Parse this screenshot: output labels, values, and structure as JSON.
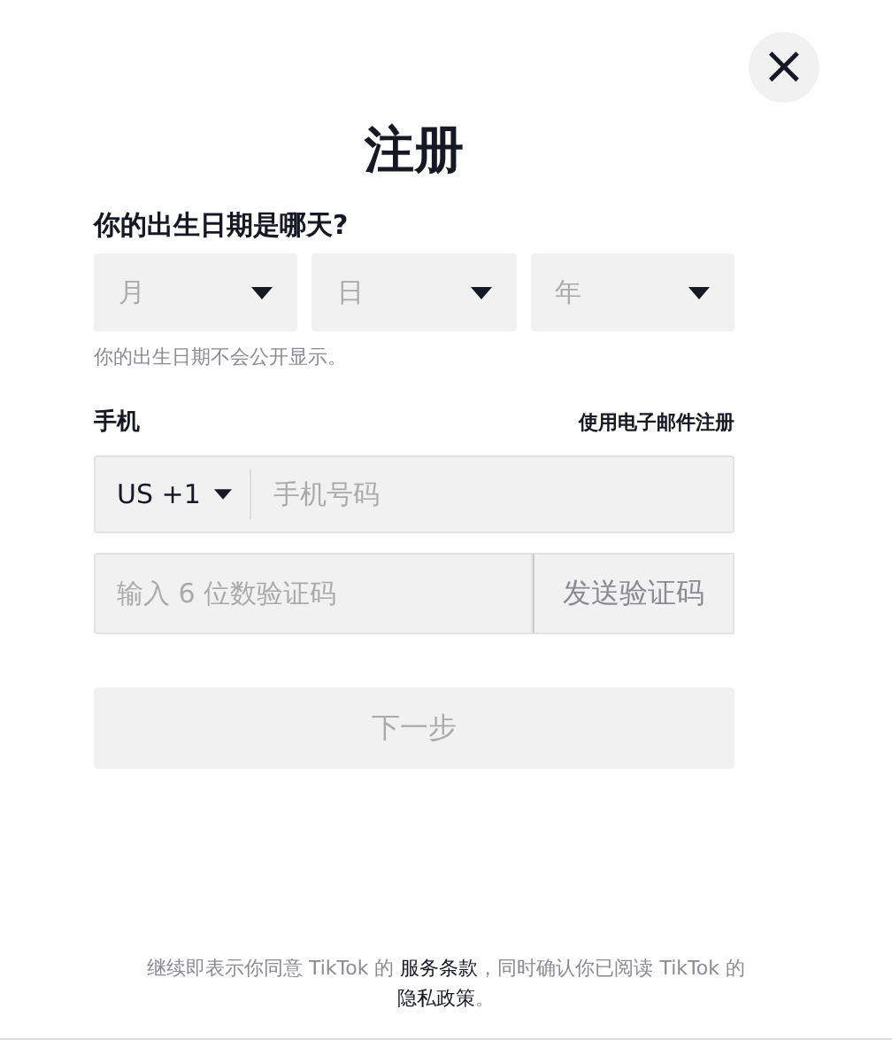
{
  "close_button": {
    "label": "×"
  },
  "title": "注册",
  "birthday": {
    "question": "你的出生日期是哪天?",
    "selects": [
      {
        "placeholder": "月"
      },
      {
        "placeholder": "日"
      },
      {
        "placeholder": "年"
      }
    ],
    "hint": "你的出生日期不会公开显示。"
  },
  "phone": {
    "label": "手机",
    "email_link": "使用电子邮件注册",
    "country_code": "US +1",
    "placeholder": "手机号码"
  },
  "code": {
    "placeholder": "输入 6 位数验证码",
    "send_button": "发送验证码"
  },
  "next_button": {
    "label": "下一步",
    "disabled": true
  },
  "footer": {
    "text_1": "继续即表示你同意 TikTok 的 ",
    "terms_link": "服务条款",
    "text_2": "，同时确认你已阅读 TikTok 的 ",
    "privacy_link": "隐私政策",
    "text_3": "。"
  }
}
